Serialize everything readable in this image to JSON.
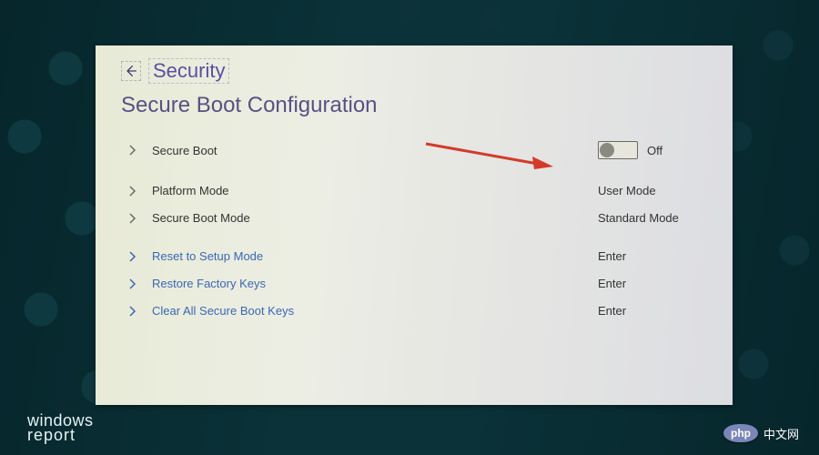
{
  "header": {
    "section": "Security"
  },
  "page": {
    "title": "Secure Boot Configuration"
  },
  "settings": {
    "secure_boot": {
      "label": "Secure Boot",
      "state": "Off"
    },
    "platform_mode": {
      "label": "Platform Mode",
      "value": "User Mode"
    },
    "secure_boot_mode": {
      "label": "Secure Boot Mode",
      "value": "Standard Mode"
    },
    "reset_setup": {
      "label": "Reset to Setup Mode",
      "action": "Enter"
    },
    "restore_keys": {
      "label": "Restore Factory Keys",
      "action": "Enter"
    },
    "clear_keys": {
      "label": "Clear All Secure Boot Keys",
      "action": "Enter"
    }
  },
  "watermarks": {
    "wr_top": "windows",
    "wr_bottom": "report",
    "php_badge": "php",
    "php_text": "中文网"
  },
  "colors": {
    "accent_purple": "#5a4fa4",
    "link_blue": "#3a68b5",
    "arrow_red": "#d43a2a"
  }
}
